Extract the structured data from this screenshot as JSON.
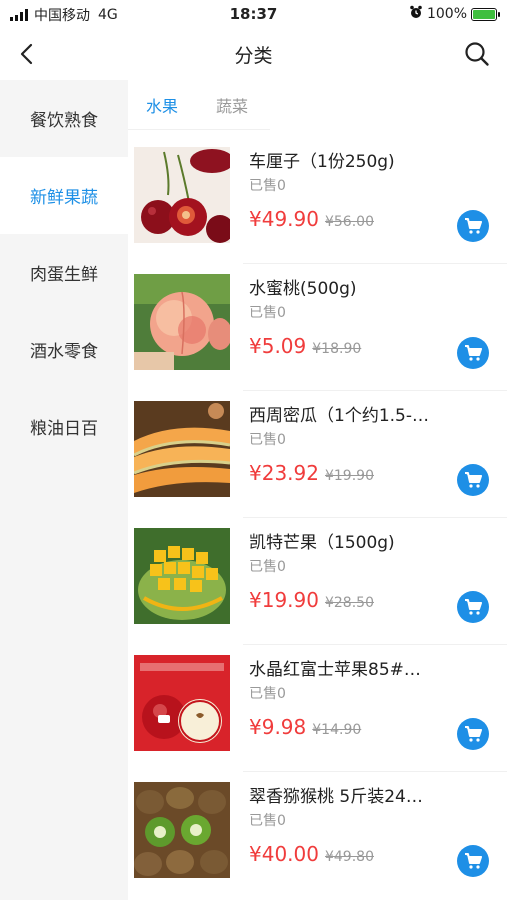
{
  "status_bar": {
    "carrier": "中国移动",
    "network": "4G",
    "time": "18:37",
    "battery_percent": "100%",
    "battery_level": 1.0,
    "icons": [
      "signal-icon",
      "alarm-icon",
      "battery-icon"
    ]
  },
  "header": {
    "title": "分类",
    "icons": [
      "back-icon",
      "search-icon"
    ]
  },
  "sidebar": {
    "items": [
      {
        "label": "餐饮熟食"
      },
      {
        "label": "新鲜果蔬"
      },
      {
        "label": "肉蛋生鲜"
      },
      {
        "label": "酒水零食"
      },
      {
        "label": "粮油日百"
      }
    ],
    "active_index": 1
  },
  "subtabs": {
    "items": [
      {
        "label": "水果"
      },
      {
        "label": "蔬菜"
      }
    ],
    "active_index": 0
  },
  "products": [
    {
      "name": "车厘子（1份250g)",
      "sold": "已售0",
      "price": "¥49.90",
      "original_price": "¥56.00"
    },
    {
      "name": "水蜜桃(500g)",
      "sold": "已售0",
      "price": "¥5.09",
      "original_price": "¥18.90"
    },
    {
      "name": "西周密瓜（1个约1.5-…",
      "sold": "已售0",
      "price": "¥23.92",
      "original_price": "¥19.90"
    },
    {
      "name": "凯特芒果（1500g)",
      "sold": "已售0",
      "price": "¥19.90",
      "original_price": "¥28.50"
    },
    {
      "name": "水晶红富士苹果85#…",
      "sold": "已售0",
      "price": "¥9.98",
      "original_price": "¥14.90"
    },
    {
      "name": "翠香猕猴桃 5斤装24…",
      "sold": "已售0",
      "price": "¥40.00",
      "original_price": "¥49.80"
    }
  ],
  "colors": {
    "accent": "#1e90e6",
    "price": "#f03c3c",
    "sidebar_bg": "#f5f5f5"
  }
}
